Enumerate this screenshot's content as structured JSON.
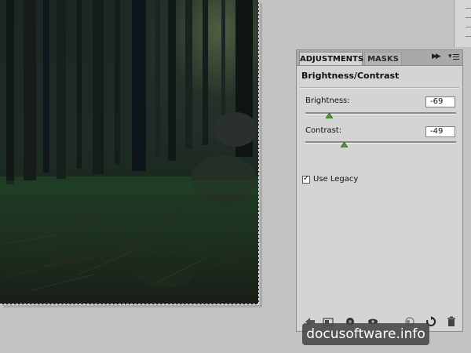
{
  "panel": {
    "tabs": [
      {
        "label": "ADJUSTMENTS",
        "active": true
      },
      {
        "label": "MASKS",
        "active": false
      }
    ],
    "title": "Brightness/Contrast",
    "brightness": {
      "label": "Brightness:",
      "value": "-69"
    },
    "contrast": {
      "label": "Contrast:",
      "value": "-49"
    },
    "use_legacy": {
      "label": "Use Legacy",
      "checked": true
    },
    "bottom_icons": [
      "back-arrow-icon",
      "panel-view-icon",
      "clip-layer-icon",
      "visibility-eye-icon",
      "view-previous-icon",
      "reset-icon",
      "trash-icon"
    ]
  },
  "watermark": "docusoftware.info",
  "colors": {
    "panel_bg": "#d4d4d4",
    "workspace_bg": "#c3c3c3",
    "slider_thumb": "#4f9a3a"
  }
}
